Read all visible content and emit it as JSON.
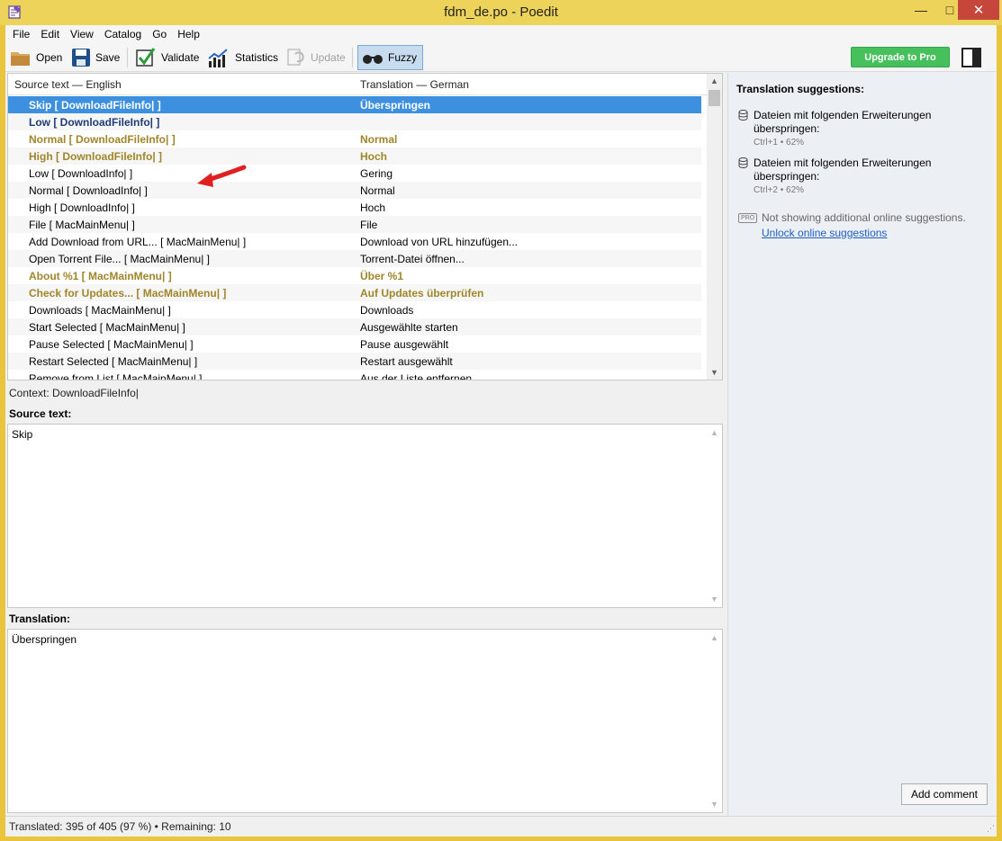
{
  "window": {
    "title": "fdm_de.po - Poedit",
    "minimize": "—",
    "maximize": "□",
    "close": "✕"
  },
  "menu": [
    "File",
    "Edit",
    "View",
    "Catalog",
    "Go",
    "Help"
  ],
  "toolbar": {
    "open": "Open",
    "save": "Save",
    "validate": "Validate",
    "statistics": "Statistics",
    "update": "Update",
    "fuzzy": "Fuzzy",
    "upgrade": "Upgrade to Pro"
  },
  "list": {
    "col_source": "Source text — English",
    "col_translation": "Translation — German",
    "rows": [
      {
        "source": "Skip  [ DownloadFileInfo| ]",
        "translation": "Überspringen",
        "state": "selected"
      },
      {
        "source": "Low  [ DownloadFileInfo| ]",
        "translation": "",
        "state": "untranslated"
      },
      {
        "source": "Normal  [ DownloadFileInfo| ]",
        "translation": "Normal",
        "state": "fuzzy"
      },
      {
        "source": "High  [ DownloadFileInfo| ]",
        "translation": "Hoch",
        "state": "fuzzy"
      },
      {
        "source": "Low  [ DownloadInfo| ]",
        "translation": "Gering",
        "state": "normal"
      },
      {
        "source": "Normal  [ DownloadInfo| ]",
        "translation": "Normal",
        "state": "normal"
      },
      {
        "source": "High  [ DownloadInfo| ]",
        "translation": "Hoch",
        "state": "normal"
      },
      {
        "source": "File  [ MacMainMenu| ]",
        "translation": "File",
        "state": "normal"
      },
      {
        "source": "Add Download from URL...  [ MacMainMenu| ]",
        "translation": "Download von URL hinzufügen...",
        "state": "normal"
      },
      {
        "source": "Open Torrent File...  [ MacMainMenu| ]",
        "translation": "Torrent-Datei öffnen...",
        "state": "normal"
      },
      {
        "source": "About %1  [ MacMainMenu| ]",
        "translation": "Über %1",
        "state": "fuzzy"
      },
      {
        "source": "Check for Updates...  [ MacMainMenu| ]",
        "translation": "Auf Updates überprüfen",
        "state": "fuzzy"
      },
      {
        "source": "Downloads  [ MacMainMenu| ]",
        "translation": "Downloads",
        "state": "normal"
      },
      {
        "source": "Start Selected  [ MacMainMenu| ]",
        "translation": "Ausgewählte starten",
        "state": "normal"
      },
      {
        "source": "Pause Selected  [ MacMainMenu| ]",
        "translation": "Pause ausgewählt",
        "state": "normal"
      },
      {
        "source": "Restart Selected  [ MacMainMenu| ]",
        "translation": "Restart ausgewählt",
        "state": "normal"
      },
      {
        "source": "Remove from List  [ MacMainMenu| ]",
        "translation": "Aus der Liste entfernen",
        "state": "normal"
      }
    ]
  },
  "editor": {
    "context": "Context: DownloadFileInfo|",
    "source_label": "Source text:",
    "source_text": "Skip",
    "translation_label": "Translation:",
    "translation_text": "Überspringen"
  },
  "status": {
    "text": "Translated: 395 of 405 (97 %)  •  Remaining: 10"
  },
  "sidebar": {
    "title": "Translation suggestions:",
    "suggestions": [
      {
        "text": "Dateien mit folgenden Erweiterungen überspringen:",
        "meta": "Ctrl+1 • 62%"
      },
      {
        "text": "Dateien mit folgenden Erweiterungen überspringen:",
        "meta": "Ctrl+2 • 62%"
      }
    ],
    "pro_badge": "PRO",
    "pro_text": "Not showing additional online suggestions.",
    "unlock_link": "Unlock online suggestions",
    "add_comment": "Add comment"
  },
  "colors": {
    "title_bar": "#edd35a",
    "selected_row": "#3d8fe0",
    "fuzzy_text": "#a0862a",
    "untranslated_text": "#1f3b78",
    "upgrade_button": "#45c05a",
    "annotation_arrow": "#e02020"
  }
}
